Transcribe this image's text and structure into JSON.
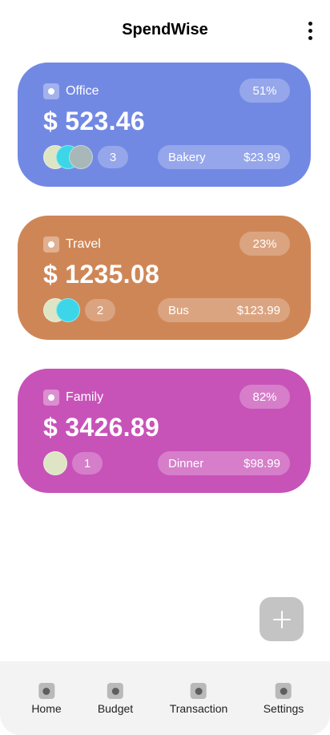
{
  "app_bar": {
    "title": "SpendWise",
    "menu_icon": "more-vert-icon"
  },
  "budgets": [
    {
      "name": "Office",
      "percent": "51%",
      "amount": "$ 523.46",
      "member_count": "3",
      "last_transaction": {
        "label": "Bakery",
        "amount": "$23.99"
      },
      "color": "#7289E4",
      "member_colors": [
        "#DDE5C4",
        "#3CD6E8",
        "#A8B8B8"
      ]
    },
    {
      "name": "Travel",
      "percent": "23%",
      "amount": "$ 1235.08",
      "member_count": "2",
      "last_transaction": {
        "label": "Bus",
        "amount": "$123.99"
      },
      "color": "#CF8656",
      "member_colors": [
        "#DDE5C4",
        "#3CD6E8"
      ]
    },
    {
      "name": "Family",
      "percent": "82%",
      "amount": "$ 3426.89",
      "member_count": "1",
      "last_transaction": {
        "label": "Dinner",
        "amount": "$98.99"
      },
      "color": "#C853B8",
      "member_colors": [
        "#DDE5C4"
      ]
    }
  ],
  "fab": {
    "icon": "plus-icon"
  },
  "bottom_nav": [
    {
      "label": "Home"
    },
    {
      "label": "Budget"
    },
    {
      "label": "Transaction"
    },
    {
      "label": "Settings"
    }
  ]
}
